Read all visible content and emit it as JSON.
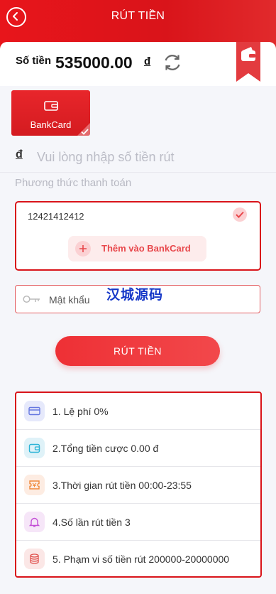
{
  "header": {
    "title": "RÚT TIỀN"
  },
  "balance": {
    "label": "Số tiền",
    "amount": "535000.00",
    "currency": "đ"
  },
  "method_tab": {
    "label": "BankCard"
  },
  "amount_field": {
    "currency": "đ",
    "placeholder": "Vui lòng nhập số tiền rút"
  },
  "payment_method": {
    "label": "Phương thức thanh toán",
    "account_number": "12421412412",
    "add_card_label": "Thêm vào BankCard"
  },
  "watermark": "汉城源码",
  "password_field": {
    "placeholder": "Mật khẩu"
  },
  "submit": {
    "label": "RÚT TIỀN"
  },
  "info": {
    "items": [
      {
        "text": "1. Lệ phí 0%",
        "icon": "fee-card-icon",
        "color": "#e6e9fb"
      },
      {
        "text": "2.Tổng tiền cược 0.00 đ",
        "icon": "wallet-icon",
        "color": "#dff2f8"
      },
      {
        "text": "3.Thời gian rút tiền 00:00-23:55",
        "icon": "ticket-icon",
        "color": "#fdece2"
      },
      {
        "text": "4.Số lần rút tiền 3",
        "icon": "bell-icon",
        "color": "#f6e6f8"
      },
      {
        "text": "5. Phạm vi số tiền rút 200000-20000000",
        "icon": "coins-icon",
        "color": "#fbe7e6"
      }
    ]
  },
  "colors": {
    "primary": "#d9141a",
    "accent": "#e8474b",
    "background": "#f5f6fa"
  }
}
